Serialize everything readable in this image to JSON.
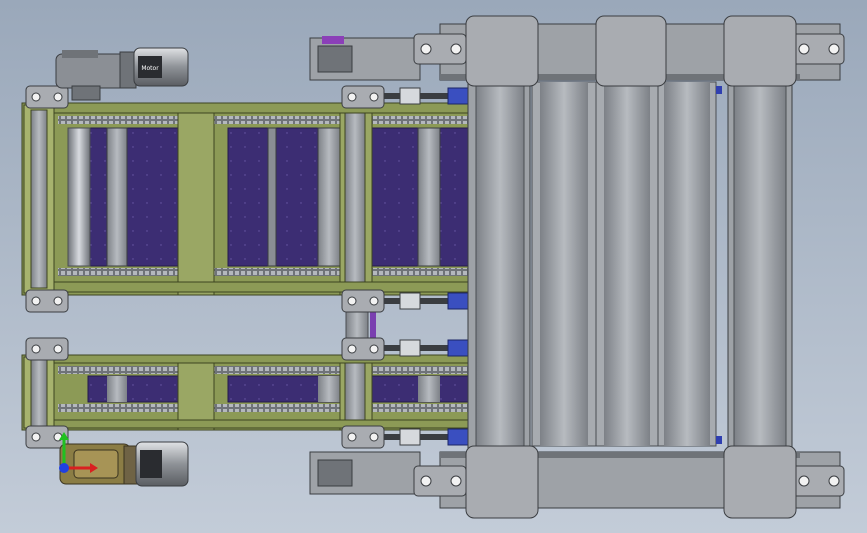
{
  "viewport": {
    "background_top": "#9aa8ba",
    "background_bottom": "#c3ccd8"
  },
  "colors": {
    "frame_green": "#8c9a56",
    "frame_green_dark": "#5d6a33",
    "steel_gray": "#8a8e94",
    "steel_light": "#b0b4b9",
    "steel_dark": "#4a4d52",
    "belt_purple": "#3c2d73",
    "belt_purple_dark": "#231a4a",
    "motor_olive": "#8b7d45",
    "accent_blue": "#2f3fb0",
    "axis_red": "#d92020",
    "axis_green": "#20c020",
    "axis_blue": "#2040e0"
  },
  "motors": [
    {
      "name": "top-gear-motor",
      "label": "Motor"
    },
    {
      "name": "bottom-gear-motor",
      "label": ""
    }
  ],
  "triad": {
    "axes": [
      "x-axis",
      "y-axis",
      "z-axis"
    ]
  }
}
